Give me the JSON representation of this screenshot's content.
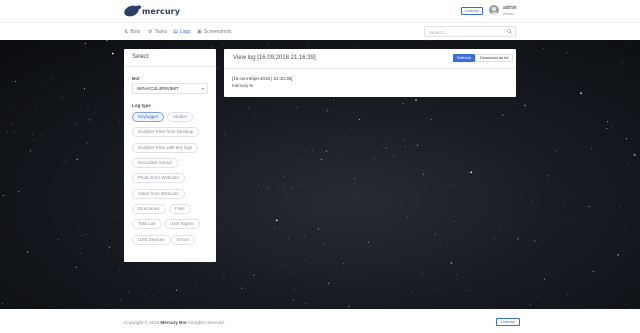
{
  "header": {
    "brand": "mercury",
    "license_label": "License",
    "user": {
      "name": "admin",
      "role": "Admin"
    }
  },
  "nav": {
    "items": [
      {
        "icon": "bots-icon",
        "label": "Bots"
      },
      {
        "icon": "tasks-icon",
        "label": "Tasks"
      },
      {
        "icon": "logs-icon",
        "label": "Logs",
        "active": true
      },
      {
        "icon": "screenshots-icon",
        "label": "Screenshots"
      }
    ],
    "search_placeholder": "Search ..."
  },
  "select_panel": {
    "title": "Select",
    "bot_label": "Bot",
    "bot_value": "WIN-KC2L4R9V9MT",
    "log_type_label": "Log type",
    "log_types": [
      "Keylogger",
      "Stealer",
      "Grabber Files from Desktop",
      "Grabber Files with key logs",
      "Recorded Sound",
      "Photo from Webcam",
      "Video from Webcam",
      "Directories",
      "Files",
      "Task List",
      "User Rights",
      "USB Devices",
      "Errors"
    ],
    "active_log_type": "Keylogger"
  },
  "log_panel": {
    "title": "View log [16.09.2018 21:16:39]",
    "refresh_label": "Refresh",
    "download_label": "Download as txt",
    "lines": [
      "[16 сентября 2018 | 21:16:35]",
      "mercury le"
    ]
  },
  "footer": {
    "copyright_prefix": "Copyright © 2018",
    "copyright_brand": "Mercury Bot",
    "copyright_suffix": "All rights reserved.",
    "license_label": "License"
  },
  "colors": {
    "accent": "#3d6dd8",
    "brand": "#2c3e66",
    "background_space": "#15181e"
  }
}
